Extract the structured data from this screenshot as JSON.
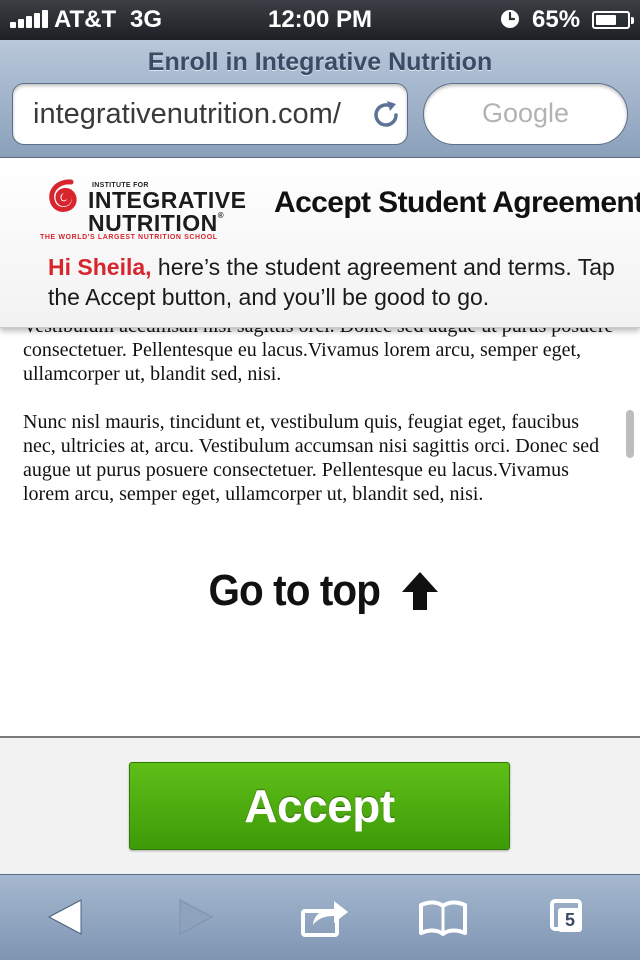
{
  "status_bar": {
    "carrier": "AT&T",
    "network": "3G",
    "time": "12:00 PM",
    "battery_percent": "65%",
    "battery_level": 0.65,
    "icons": [
      "signal-bars-icon",
      "alarm-clock-icon",
      "battery-icon"
    ]
  },
  "browser": {
    "page_title": "Enroll in Integrative Nutrition",
    "url": "integrativenutrition.com/",
    "search_placeholder": "Google",
    "toolbar": {
      "icons": [
        "back-arrow-icon",
        "forward-arrow-icon",
        "share-icon",
        "bookmarks-icon",
        "tabs-icon"
      ],
      "tabs_count": "5"
    }
  },
  "header": {
    "logo": {
      "small_text": "INSTITUTE FOR",
      "line1": "INTEGRATIVE",
      "line2": "NUTRITION",
      "registered": "®",
      "tagline": "THE WORLD'S LARGEST NUTRITION SCHOOL"
    },
    "title": "Accept Student Agreement",
    "greeting_name": "Hi Sheila,",
    "greeting_text": " here’s the student agreement and terms. Tap the Accept button, and you’ll be good to go."
  },
  "content": {
    "paragraph_partial": "Vestibulum accumsan nisi sagittis orci. Donec sed augue ut purus posuere consectetuer. Pellentesque eu lacus.Vivamus lorem arcu, semper eget, ullamcorper ut, blandit sed, nisi.",
    "paragraph_2": "Nunc nisl mauris, tincidunt et, vestibulum quis, feugiat eget, faucibus nec, ultricies at, arcu. Vestibulum accumsan nisi sagittis orci. Donec sed augue ut purus posuere consectetuer. Pellentesque eu lacus.Vivamus lorem arcu, semper eget, ullamcorper ut, blandit sed, nisi.",
    "go_to_top": "Go to top"
  },
  "actions": {
    "accept_label": "Accept"
  },
  "colors": {
    "brand_red": "#d7262e",
    "accept_green": "#4caf10",
    "browser_blue": "#8aa0bb"
  }
}
